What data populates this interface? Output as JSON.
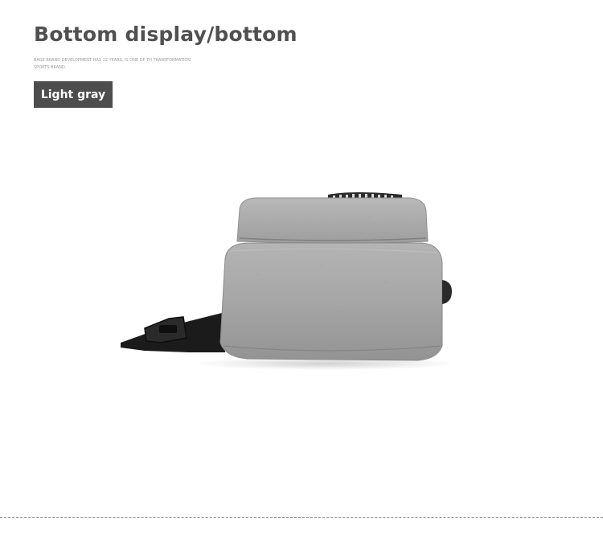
{
  "header": {
    "title": "Bottom display/bottom",
    "subtitle": "BAGE BRAND DEVELOPMENT HAS 22 YEARS, IS ONE OF TH TRANSFORMATION SPORTS BRAND.",
    "color_badge": "Light gray"
  },
  "product_image": {
    "subject": "gray sling bag bottom view",
    "fabric_color": "#a8a8a8",
    "strap_color": "#1a1a1a"
  }
}
